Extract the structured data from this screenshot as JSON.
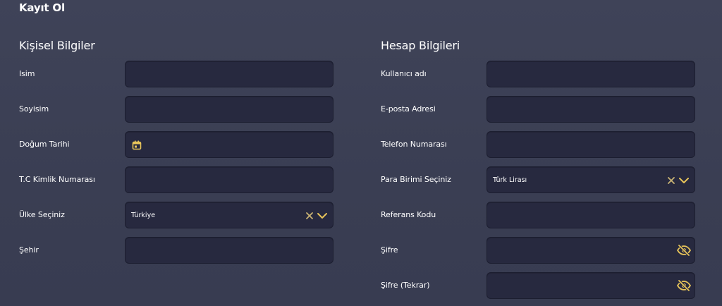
{
  "page": {
    "title": "Kayıt Ol"
  },
  "personal": {
    "title": "Kişisel Bilgiler",
    "fields": [
      {
        "label": "Isim",
        "value": ""
      },
      {
        "label": "Soyisim",
        "value": ""
      },
      {
        "label": "Doğum Tarihi",
        "value": "",
        "icon": "calendar-icon"
      },
      {
        "label": "T.C Kimlik Numarası",
        "value": ""
      },
      {
        "label": "Ülke Seçiniz",
        "value": "Türkiye",
        "icons": [
          "clear-icon",
          "chevron-down-icon"
        ]
      },
      {
        "label": "Şehir",
        "value": ""
      }
    ]
  },
  "account": {
    "title": "Hesap Bilgileri",
    "fields": [
      {
        "label": "Kullanıcı adı",
        "value": ""
      },
      {
        "label": "E-posta Adresi",
        "value": ""
      },
      {
        "label": "Telefon Numarası",
        "value": ""
      },
      {
        "label": "Para Birimi Seçiniz",
        "value": "Türk Lirası",
        "icons": [
          "clear-icon",
          "chevron-down-icon"
        ]
      },
      {
        "label": "Referans Kodu",
        "value": ""
      },
      {
        "label": "Şifre",
        "value": "",
        "icon": "eye-slash-icon"
      },
      {
        "label": "Şifre (Tekrar)",
        "value": "",
        "icon": "eye-slash-icon"
      }
    ]
  },
  "colors": {
    "accent": "#e7c45a",
    "field_bg": "#27293f",
    "background": "#3d4156"
  }
}
